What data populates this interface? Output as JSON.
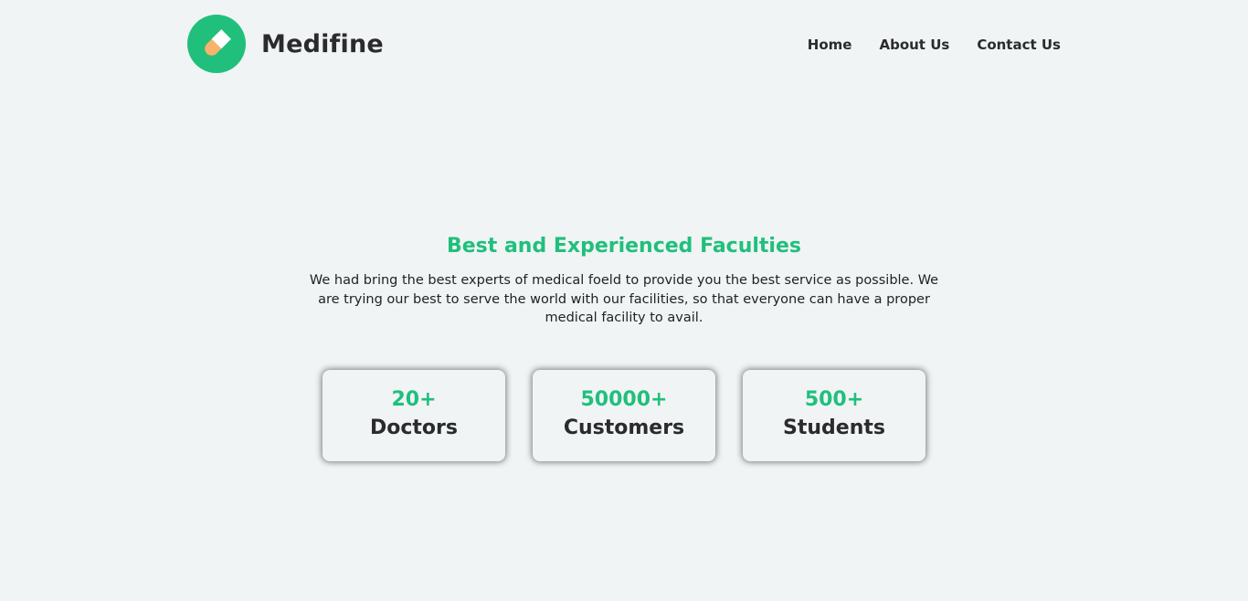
{
  "brand": {
    "name": "Medifine",
    "logo_icon": "pill-icon",
    "accent_color": "#21bf7c"
  },
  "nav": {
    "items": [
      {
        "label": "Home"
      },
      {
        "label": "About Us"
      },
      {
        "label": "Contact Us"
      }
    ]
  },
  "hero": {
    "title": "Best and Experienced Faculties",
    "description": "We had bring the best experts of medical foeld to provide you the best service as possible. We are trying our best to serve the world with our facilities, so that everyone can have a proper medical facility to avail."
  },
  "stats": [
    {
      "number": "20+",
      "label": "Doctors"
    },
    {
      "number": "50000+",
      "label": "Customers"
    },
    {
      "number": "500+",
      "label": "Students"
    }
  ]
}
